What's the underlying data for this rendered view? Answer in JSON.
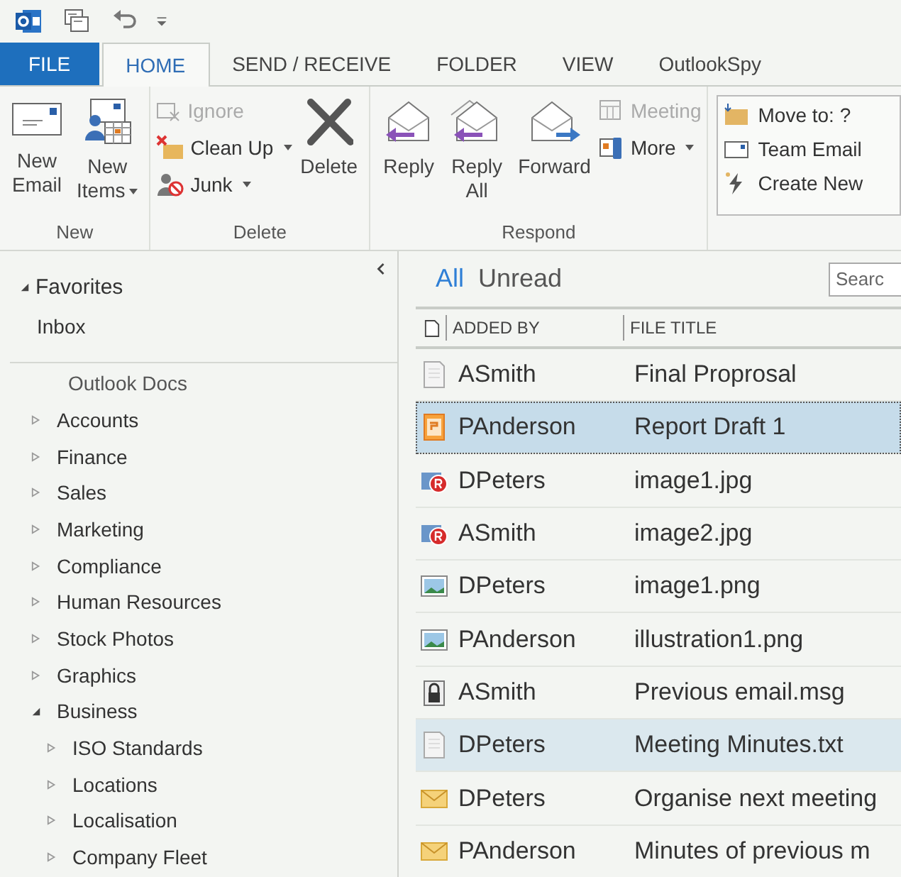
{
  "ribbon": {
    "tabs": [
      {
        "label": "FILE",
        "kind": "file",
        "selected": false
      },
      {
        "label": "HOME",
        "kind": "tab",
        "selected": true
      },
      {
        "label": "SEND / RECEIVE",
        "kind": "tab",
        "selected": false
      },
      {
        "label": "FOLDER",
        "kind": "tab",
        "selected": false
      },
      {
        "label": "VIEW",
        "kind": "tab",
        "selected": false
      },
      {
        "label": "OutlookSpy",
        "kind": "tab",
        "selected": false
      }
    ],
    "groups": [
      {
        "label": "New",
        "items": [
          {
            "kind": "large",
            "lines": [
              "New",
              "Email"
            ],
            "dropdown": false,
            "disabled": false
          },
          {
            "kind": "large",
            "lines": [
              "New",
              "Items"
            ],
            "dropdown": true,
            "disabled": false
          }
        ]
      },
      {
        "label": "Delete",
        "items": [
          {
            "kind": "stack",
            "items": [
              {
                "label": "Ignore",
                "dropdown": false,
                "disabled": true
              },
              {
                "label": "Clean Up",
                "dropdown": true,
                "disabled": false
              },
              {
                "label": "Junk",
                "dropdown": true,
                "disabled": false
              }
            ]
          },
          {
            "kind": "large",
            "lines": [
              "Delete"
            ],
            "dropdown": false,
            "disabled": false
          }
        ]
      },
      {
        "label": "Respond",
        "items": [
          {
            "kind": "large",
            "lines": [
              "Reply"
            ],
            "dropdown": false,
            "disabled": false
          },
          {
            "kind": "large",
            "lines": [
              "Reply",
              "All"
            ],
            "dropdown": false,
            "disabled": false
          },
          {
            "kind": "large",
            "lines": [
              "Forward"
            ],
            "dropdown": false,
            "disabled": false
          },
          {
            "kind": "stack",
            "items": [
              {
                "label": "Meeting",
                "dropdown": false,
                "disabled": true
              },
              {
                "label": "More",
                "dropdown": true,
                "disabled": false
              }
            ]
          }
        ]
      }
    ],
    "quick_steps": [
      "Move to: ?",
      "Team Email",
      "Create New"
    ]
  },
  "navigation": {
    "favorites": {
      "label": "Favorites",
      "expanded": true,
      "children": [
        {
          "label": "Inbox"
        }
      ]
    },
    "mailbox": {
      "label": "Outlook Docs",
      "children": [
        {
          "label": "Accounts",
          "expanded": false
        },
        {
          "label": "Finance",
          "expanded": false
        },
        {
          "label": "Sales",
          "expanded": false
        },
        {
          "label": "Marketing",
          "expanded": false
        },
        {
          "label": "Compliance",
          "expanded": false
        },
        {
          "label": "Human Resources",
          "expanded": false
        },
        {
          "label": "Stock Photos",
          "expanded": false
        },
        {
          "label": "Graphics",
          "expanded": false
        },
        {
          "label": "Business",
          "expanded": true,
          "children": [
            {
              "label": "ISO Standards",
              "expanded": false
            },
            {
              "label": "Locations",
              "expanded": false
            },
            {
              "label": "Localisation",
              "expanded": false
            },
            {
              "label": "Company Fleet",
              "expanded": false
            }
          ]
        }
      ]
    }
  },
  "message_list": {
    "filters": [
      {
        "label": "All",
        "selected": true
      },
      {
        "label": "Unread",
        "selected": false
      }
    ],
    "search": {
      "placeholder": "Searc"
    },
    "columns": [
      "ADDED BY",
      "FILE TITLE"
    ],
    "rows": [
      {
        "kind": "document",
        "added_by": "ASmith",
        "title": "Final Proprosal",
        "selected": false,
        "hovered": false
      },
      {
        "kind": "pdf",
        "added_by": "PAnderson",
        "title": "Report Draft 1",
        "selected": true,
        "hovered": false
      },
      {
        "kind": "restricted",
        "added_by": "DPeters",
        "title": "image1.jpg",
        "selected": false,
        "hovered": false
      },
      {
        "kind": "restricted",
        "added_by": "ASmith",
        "title": "image2.jpg",
        "selected": false,
        "hovered": false
      },
      {
        "kind": "image",
        "added_by": "DPeters",
        "title": "image1.png",
        "selected": false,
        "hovered": false
      },
      {
        "kind": "image",
        "added_by": "PAnderson",
        "title": "illustration1.png",
        "selected": false,
        "hovered": false
      },
      {
        "kind": "message",
        "added_by": "ASmith",
        "title": "Previous email.msg",
        "selected": false,
        "hovered": false
      },
      {
        "kind": "document",
        "added_by": "DPeters",
        "title": "Meeting Minutes.txt",
        "selected": false,
        "hovered": true
      },
      {
        "kind": "mail",
        "added_by": "DPeters",
        "title": "Organise next meeting",
        "selected": false,
        "hovered": false
      },
      {
        "kind": "mail",
        "added_by": "PAnderson",
        "title": "Minutes of previous m",
        "selected": false,
        "hovered": false
      }
    ]
  }
}
